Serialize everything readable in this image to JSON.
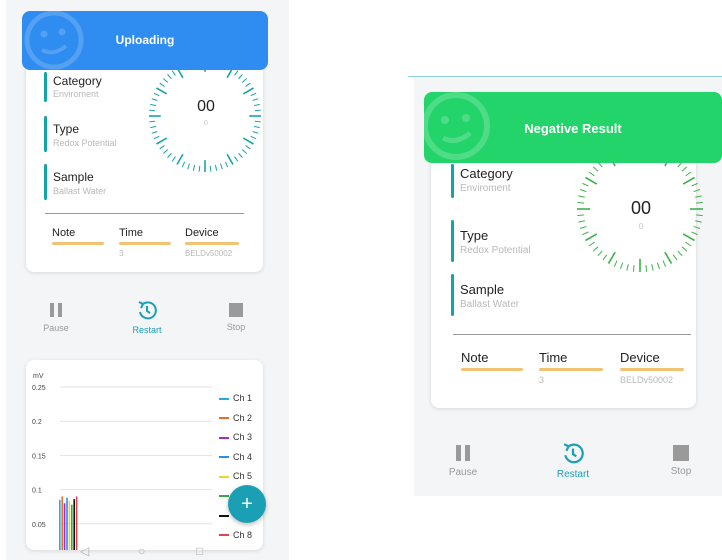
{
  "left_screen": {
    "toast": {
      "text": "Uploading",
      "color": "#2f8cf1"
    },
    "info": [
      {
        "label": "Category",
        "value": "Enviroment"
      },
      {
        "label": "Type",
        "value": "Redox Potential"
      },
      {
        "label": "Sample",
        "value": "Ballast Water"
      }
    ],
    "dial": {
      "main": "00",
      "sub": "0"
    },
    "meta": [
      {
        "label": "Note",
        "value": ""
      },
      {
        "label": "Time",
        "value": "3"
      },
      {
        "label": "Device",
        "value": "BELDv50002"
      }
    ],
    "controls": [
      {
        "label": "Pause",
        "icon": "pause-icon",
        "active": false
      },
      {
        "label": "Restart",
        "icon": "restart-icon",
        "active": true
      },
      {
        "label": "Stop",
        "icon": "stop-icon",
        "active": false
      }
    ],
    "chart": {
      "unit": "mV",
      "fab_label": "+",
      "legend": [
        {
          "name": "Ch 1",
          "color": "#2aa8e0"
        },
        {
          "name": "Ch 2",
          "color": "#ef6a2b"
        },
        {
          "name": "Ch 3",
          "color": "#9b2fc7"
        },
        {
          "name": "Ch 4",
          "color": "#2e8ee6"
        },
        {
          "name": "Ch 5",
          "color": "#f0d42a"
        },
        {
          "name": "",
          "color": "#3aa94a"
        },
        {
          "name": "",
          "color": "#111111"
        },
        {
          "name": "Ch 8",
          "color": "#e0444a"
        }
      ]
    },
    "nav": {
      "back": "◁",
      "home": "○",
      "recent": "□"
    }
  },
  "right_screen": {
    "toast": {
      "text": "Negative Result",
      "color": "#22d46a"
    },
    "info": [
      {
        "label": "Category",
        "value": "Enviroment"
      },
      {
        "label": "Type",
        "value": "Redox Potential"
      },
      {
        "label": "Sample",
        "value": "Ballast Water"
      }
    ],
    "dial": {
      "main": "00",
      "sub": "0"
    },
    "meta": [
      {
        "label": "Note",
        "value": ""
      },
      {
        "label": "Time",
        "value": "3"
      },
      {
        "label": "Device",
        "value": "BELDv50002"
      }
    ],
    "controls": [
      {
        "label": "Pause",
        "icon": "pause-icon",
        "active": false
      },
      {
        "label": "Restart",
        "icon": "restart-icon",
        "active": true
      },
      {
        "label": "Stop",
        "icon": "stop-icon",
        "active": false
      }
    ]
  },
  "chart_data": {
    "type": "bar",
    "ylabel": "mV",
    "yticks": [
      0.05,
      0.1,
      0.15,
      0.2,
      0.25
    ],
    "ylim": [
      0,
      0.25
    ],
    "series": [
      {
        "name": "Ch 1",
        "values": [
          0.085
        ]
      },
      {
        "name": "Ch 2",
        "values": [
          0.09
        ]
      },
      {
        "name": "Ch 3",
        "values": [
          0.08
        ]
      },
      {
        "name": "Ch 4",
        "values": [
          0.088
        ]
      },
      {
        "name": "Ch 5",
        "values": [
          0.083
        ]
      },
      {
        "values": [
          0.078
        ]
      },
      {
        "values": [
          0.086
        ]
      },
      {
        "name": "Ch 8",
        "values": [
          0.09
        ]
      }
    ]
  }
}
